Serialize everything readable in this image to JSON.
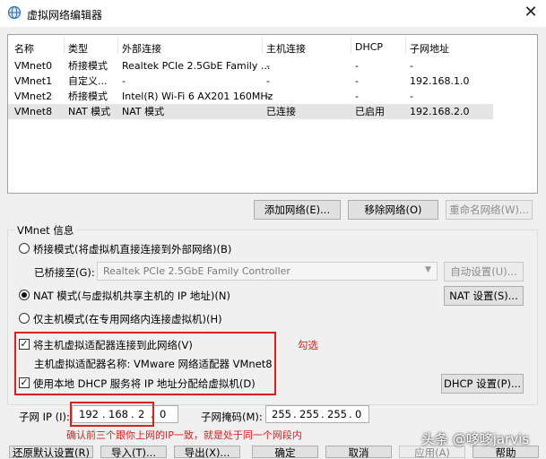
{
  "window": {
    "title": "虚拟网络编辑器"
  },
  "columns": [
    "名称",
    "类型",
    "外部连接",
    "主机连接",
    "DHCP",
    "子网地址"
  ],
  "rows": [
    {
      "name": "VMnet0",
      "type": "桥接模式",
      "external": "Realtek PCIe 2.5GbE Family ...",
      "host": "-",
      "dhcp": "-",
      "subnet": "-"
    },
    {
      "name": "VMnet1",
      "type": "自定义...",
      "external": "-",
      "host": "-",
      "dhcp": "-",
      "subnet": "192.168.1.0"
    },
    {
      "name": "VMnet2",
      "type": "桥接模式",
      "external": "Intel(R) Wi-Fi 6 AX201 160MHz",
      "host": "-",
      "dhcp": "-",
      "subnet": "-"
    },
    {
      "name": "VMnet8",
      "type": "NAT 模式",
      "external": "NAT 模式",
      "host": "已连接",
      "dhcp": "已启用",
      "subnet": "192.168.2.0"
    }
  ],
  "list_buttons": {
    "add": "添加网络(E)...",
    "remove": "移除网络(O)",
    "rename": "重命名网络(W)..."
  },
  "vmnet_info": {
    "title": "VMnet 信息",
    "bridge_mode": "桥接模式(将虚拟机直接连接到外部网络)(B)",
    "bridged_to_label": "已桥接至(G):",
    "bridged_to_value": "Realtek PCIe 2.5GbE Family Controller",
    "auto_settings": "自动设置(U)...",
    "nat_mode": "NAT 模式(与虚拟机共享主机的 IP 地址)(N)",
    "nat_settings": "NAT 设置(S)...",
    "host_only": "仅主机模式(在专用网络内连接虚拟机)(H)",
    "connect_adapter": "将主机虚拟适配器连接到此网络(V)",
    "adapter_name": "主机虚拟适配器名称: VMware 网络适配器 VMnet8",
    "use_dhcp": "使用本地 DHCP 服务将 IP 地址分配给虚拟机(D)",
    "dhcp_settings": "DHCP 设置(P)...",
    "subnet_ip_label": "子网 IP (I):",
    "subnet_ip": [
      "192",
      "168",
      "2",
      "0"
    ],
    "subnet_mask_label": "子网掩码(M):",
    "subnet_mask": [
      "255",
      "255",
      "255",
      "0"
    ]
  },
  "annotations": {
    "check_note": "勾选",
    "ip_note": "确认前三个跟你上网的IP一致，就是处于同一个网段内"
  },
  "bottom_buttons": {
    "restore": "还原默认设置(R)",
    "import": "导入(T)...",
    "export": "导出(X)...",
    "ok": "确定",
    "cancel": "取消",
    "apply": "应用(A)",
    "help": "帮助"
  },
  "watermark": "头条 @哆哆jarvis",
  "colors": {
    "annotation": "#d9201f",
    "selected_row": "#e5e5e5"
  }
}
